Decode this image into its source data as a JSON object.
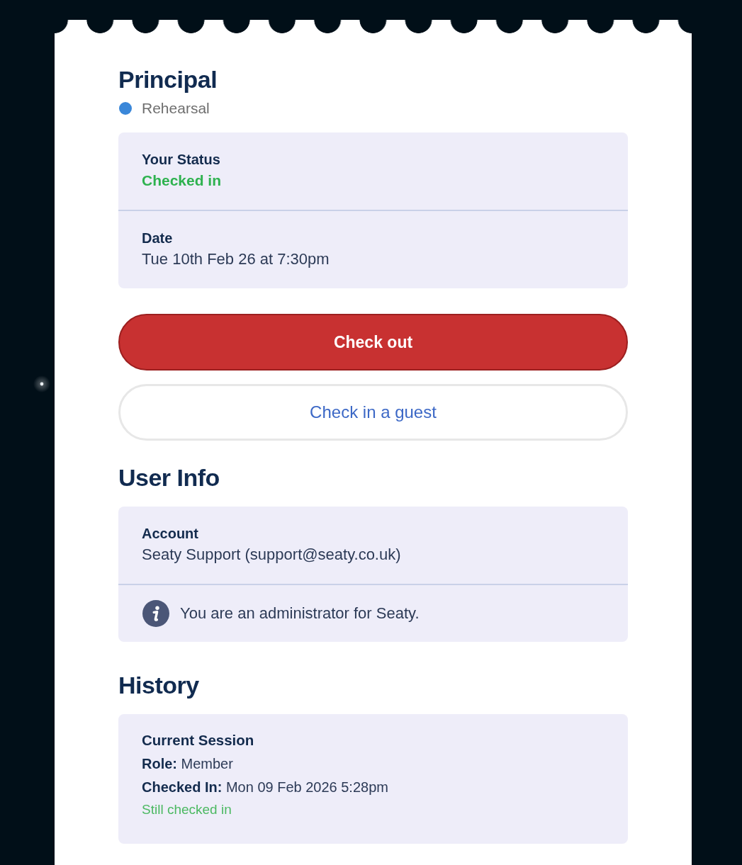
{
  "event": {
    "title": "Principal",
    "type_label": "Rehearsal"
  },
  "details": [
    {
      "kind": "status",
      "label": "Your Status",
      "value": "Checked in"
    },
    {
      "kind": "text",
      "label": "Date",
      "value": "Tue 10th Feb 26 at 7:30pm"
    }
  ],
  "actions": [
    {
      "kind": "danger",
      "label": "Check out"
    },
    {
      "kind": "outline",
      "label": "Check in a guest"
    }
  ],
  "user_info": {
    "heading": "User Info",
    "rows": [
      {
        "kind": "field",
        "label": "Account",
        "value": "Seaty Support (support@seaty.co.uk)"
      },
      {
        "kind": "notice",
        "text": "You are an administrator for Seaty."
      }
    ]
  },
  "history": {
    "heading": "History",
    "sessions": [
      {
        "title": "Current Session",
        "lines": [
          "**Role:** Member",
          "**Checked In:** Mon 09 Feb 2026 5:28pm"
        ],
        "status": "Still checked in"
      }
    ]
  }
}
